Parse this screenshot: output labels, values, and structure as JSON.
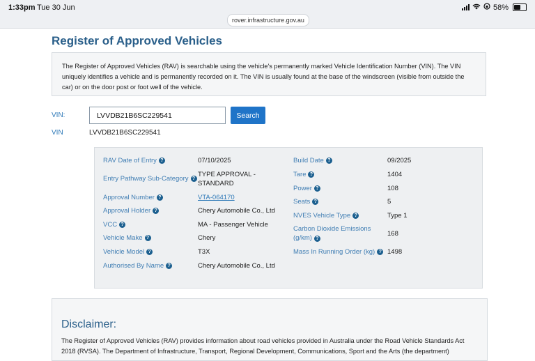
{
  "statusbar": {
    "time": "1:33pm",
    "date": "Tue 30 Jun",
    "url": "rover.infrastructure.gov.au",
    "battery": "58%"
  },
  "page": {
    "title": "Register of Approved Vehicles",
    "intro": "The Register of Approved Vehicles (RAV) is searchable using the vehicle's permanently marked Vehicle Identification Number (VIN). The VIN uniquely identifies a vehicle and is permanently recorded on it. The VIN is usually found at the base of the windscreen (visible from outside the car) or on the door post or foot well of the vehicle."
  },
  "search": {
    "label": "VIN:",
    "value": "LVVDB21B6SC229541",
    "button": "Search",
    "result_label": "VIN",
    "result_value": "LVVDB21B6SC229541"
  },
  "details": {
    "rav_date": {
      "label": "RAV Date of Entry",
      "value": "07/10/2025"
    },
    "pathway": {
      "label": "Entry Pathway Sub-Category",
      "value": "TYPE APPROVAL - STANDARD"
    },
    "approval_number": {
      "label": "Approval Number",
      "value": "VTA-064170"
    },
    "approval_holder": {
      "label": "Approval Holder",
      "value": "Chery Automobile Co., Ltd"
    },
    "vcc": {
      "label": "VCC",
      "value": "MA - Passenger Vehicle"
    },
    "make": {
      "label": "Vehicle Make",
      "value": "Chery"
    },
    "model": {
      "label": "Vehicle Model",
      "value": "T3X"
    },
    "authorised": {
      "label": "Authorised By Name",
      "value": "Chery Automobile Co., Ltd"
    },
    "build_date": {
      "label": "Build Date",
      "value": "09/2025"
    },
    "tare": {
      "label": "Tare",
      "value": "1404"
    },
    "power": {
      "label": "Power",
      "value": "108"
    },
    "seats": {
      "label": "Seats",
      "value": "5"
    },
    "nves": {
      "label": "NVES Vehicle Type",
      "value": "Type 1"
    },
    "co2": {
      "label": "Carbon Dioxide Emissions (g/km)",
      "value": "168"
    },
    "mass": {
      "label": "Mass In Running Order (kg)",
      "value": "1498"
    }
  },
  "disclaimer": {
    "title": "Disclaimer:",
    "text": "The Register of Approved Vehicles (RAV) provides information about road vehicles provided in Australia under the Road Vehicle Standards Act 2018 (RVSA). The Department of Infrastructure, Transport, Regional Development, Communications, Sport and the Arts (the department)"
  },
  "icons": {
    "help": "question-circle-icon",
    "signal": "cellular-signal-icon",
    "wifi": "wifi-icon",
    "battery": "battery-icon"
  },
  "colors": {
    "title": "#2a5f8a",
    "label": "#3f7db3",
    "button": "#1f74c8",
    "help_icon": "#1b5f8f"
  }
}
